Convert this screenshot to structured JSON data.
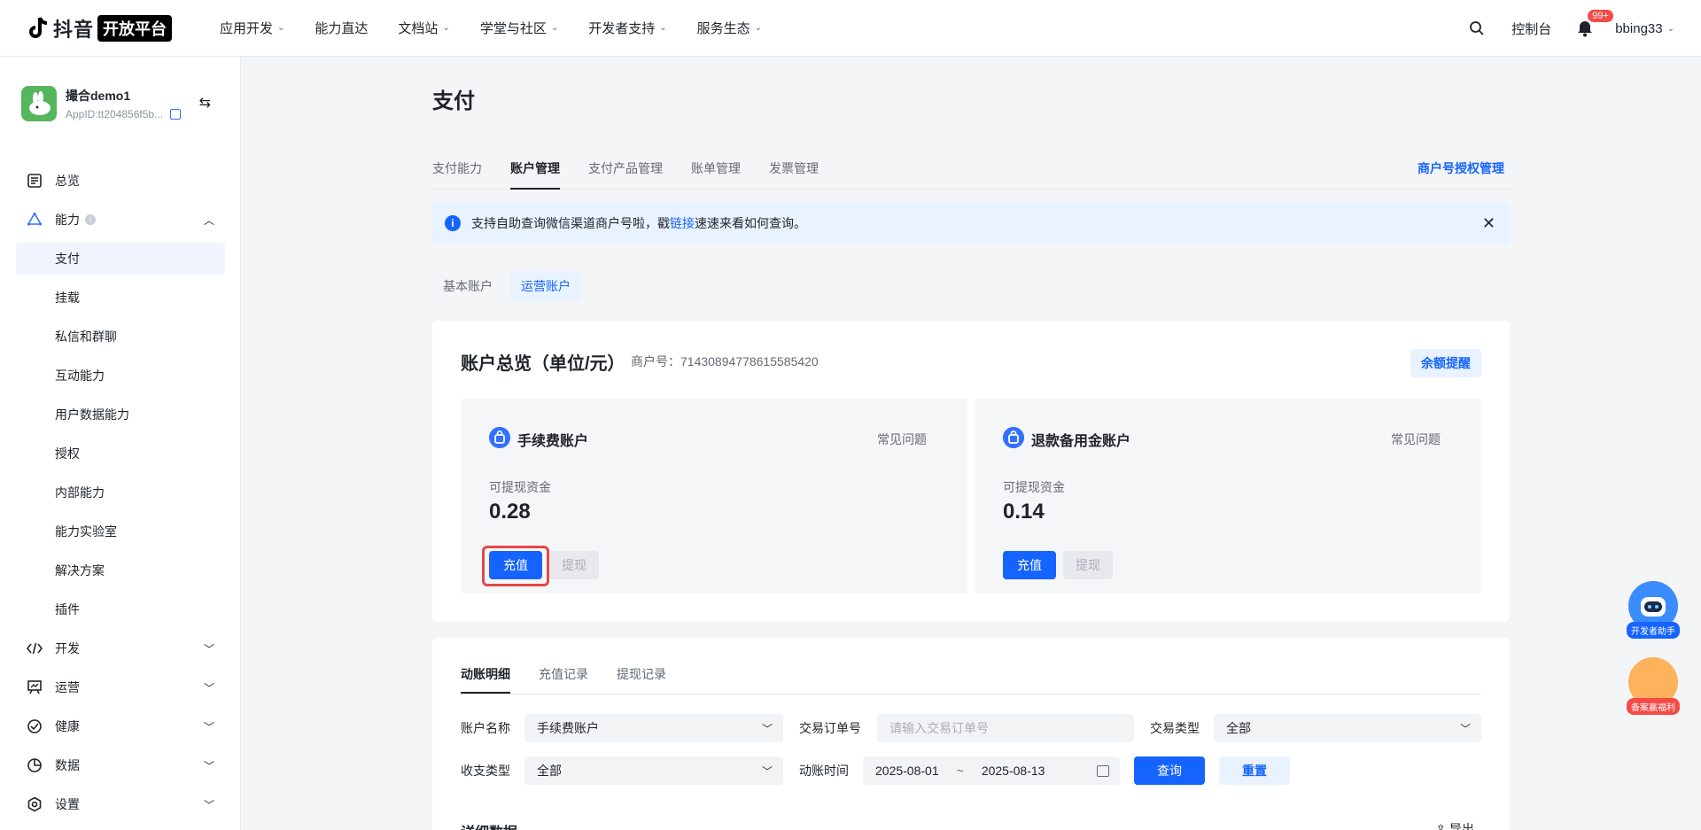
{
  "topbar": {
    "brand": "抖音",
    "badge": "开放平台",
    "nav": [
      {
        "label": "应用开发",
        "chev": true
      },
      {
        "label": "能力直达",
        "chev": false
      },
      {
        "label": "文档站",
        "chev": true
      },
      {
        "label": "学堂与社区",
        "chev": true
      },
      {
        "label": "开发者支持",
        "chev": true
      },
      {
        "label": "服务生态",
        "chev": true
      }
    ],
    "console": "控制台",
    "bell_badge": "99+",
    "user": "bbing33"
  },
  "sidebar": {
    "app_name": "撮合demo1",
    "app_id": "AppID:tt204856f5b...",
    "menu": {
      "overview": "总览",
      "ability": "能力",
      "ability_sub": [
        "支付",
        "挂载",
        "私信和群聊",
        "互动能力",
        "用户数据能力",
        "授权",
        "内部能力",
        "能力实验室",
        "解决方案",
        "插件"
      ],
      "develop": "开发",
      "operate": "运营",
      "health": "健康",
      "data": "数据",
      "settings": "设置"
    }
  },
  "main": {
    "title": "支付",
    "tabs": [
      "支付能力",
      "账户管理",
      "支付产品管理",
      "账单管理",
      "发票管理"
    ],
    "active_tab": 1,
    "tab_right": "商户号授权管理",
    "notice": {
      "before": "支持自助查询微信渠道商户号啦，戳",
      "link": "链接",
      "after": "速速来看如何查询。"
    },
    "subtabs": [
      "基本账户",
      "运营账户"
    ],
    "overview": {
      "title": "账户总览（单位/元）",
      "merchant": "商户号：71430894778615585420",
      "remind": "余额提醒",
      "accounts": [
        {
          "name": "手续费账户",
          "faq": "常见问题",
          "label": "可提现资金",
          "amount": "0.28",
          "recharge": "充值",
          "withdraw": "提现"
        },
        {
          "name": "退款备用金账户",
          "faq": "常见问题",
          "label": "可提现资金",
          "amount": "0.14",
          "recharge": "充值",
          "withdraw": "提现"
        }
      ]
    },
    "details": {
      "tabs": [
        "动账明细",
        "充值记录",
        "提现记录"
      ],
      "filters": {
        "account_label": "账户名称",
        "account_value": "手续费账户",
        "order_label": "交易订单号",
        "order_placeholder": "请输入交易订单号",
        "type_label": "交易类型",
        "type_value": "全部",
        "inout_label": "收支类型",
        "inout_value": "全部",
        "time_label": "动账时间",
        "date_from": "2025-08-01",
        "date_sep": "~",
        "date_to": "2025-08-13",
        "query": "查询",
        "reset": "重置"
      },
      "section_title": "详细数据",
      "export": "导出"
    }
  },
  "floating": {
    "assistant": "开发者助手",
    "welfare": "备案赢福利"
  }
}
